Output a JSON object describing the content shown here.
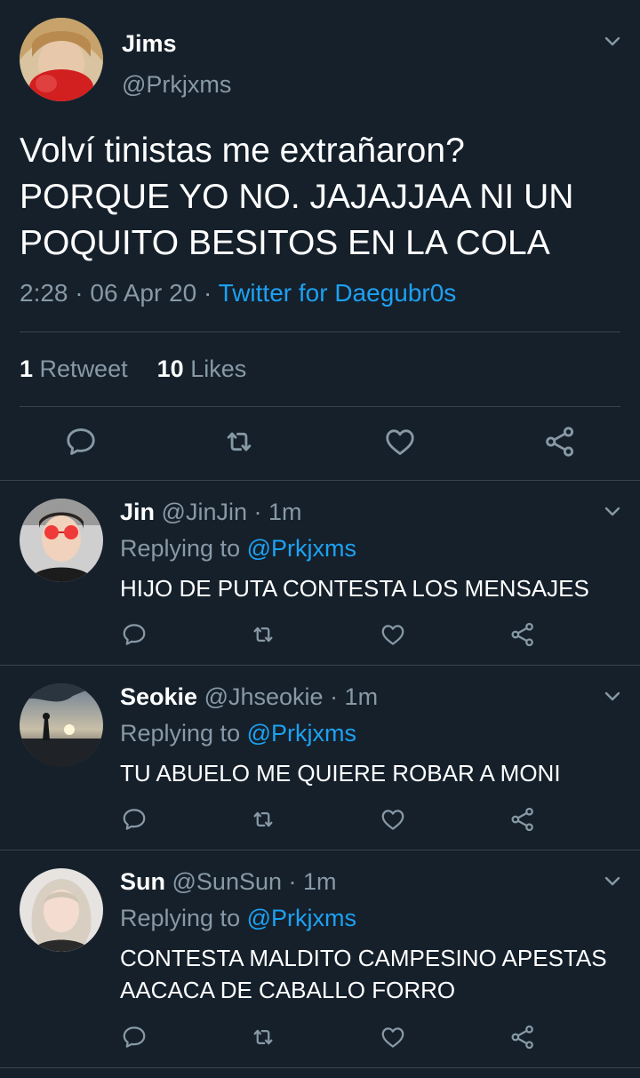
{
  "colors": {
    "background": "#15202b",
    "text": "#ffffff",
    "secondary": "#8899a6",
    "accent": "#1da1f2",
    "divider": "#38444d"
  },
  "main_tweet": {
    "name": "Jims",
    "handle": "@Prkjxms",
    "text": "Volví tinistas me extrañaron? PORQUE YO NO. JAJAJJAA NI UN POQUITO BESITOS EN LA COLA",
    "time": "2:28 · 06 Apr 20 · ",
    "source": "Twitter for Daegubr0s",
    "retweet_count": "1",
    "retweet_label": "Retweet",
    "like_count": "10",
    "like_label": "Likes",
    "menu_icon": "chevron-down-icon",
    "actions": [
      "reply-icon",
      "retweet-icon",
      "like-icon",
      "share-icon"
    ]
  },
  "replies": [
    {
      "name": "Jin",
      "handle": "@JinJin",
      "time": " · 1m",
      "replying_label": "Replying to ",
      "mention": "@Prkjxms",
      "text": "HIJO DE PUTA CONTESTA LOS MENSAJES"
    },
    {
      "name": "Seokie",
      "handle": "@Jhseokie",
      "time": " · 1m",
      "replying_label": "Replying to ",
      "mention": "@Prkjxms",
      "text": "TU ABUELO ME QUIERE ROBAR A MONI"
    },
    {
      "name": "Sun",
      "handle": "@SunSun",
      "time": " · 1m",
      "replying_label": "Replying to ",
      "mention": "@Prkjxms",
      "text": "CONTESTA MALDITO CAMPESINO APESTAS AACACA DE CABALLO FORRO"
    }
  ]
}
